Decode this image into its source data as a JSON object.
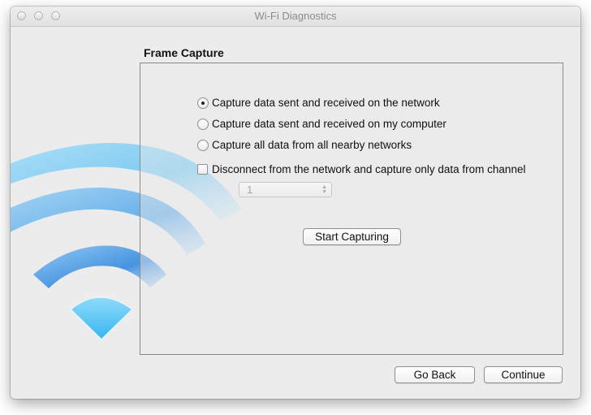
{
  "window": {
    "title": "Wi-Fi Diagnostics"
  },
  "section": {
    "title": "Frame Capture"
  },
  "capture_options": [
    {
      "label": "Capture data sent and received on the network",
      "selected": true
    },
    {
      "label": "Capture data sent and received on my computer",
      "selected": false
    },
    {
      "label": "Capture all data from all nearby networks",
      "selected": false
    }
  ],
  "disconnect": {
    "label": "Disconnect from the network and capture only data from channel",
    "checked": false
  },
  "channel": {
    "value": "1",
    "enabled": false
  },
  "buttons": {
    "start_capturing": "Start Capturing",
    "go_back": "Go Back",
    "continue": "Continue"
  },
  "icons": {
    "wifi": "wifi-icon",
    "stepper": "stepper-arrows-icon"
  },
  "colors": {
    "wifi_light": "#8fd5f6",
    "wifi_mid": "#5bb4ec",
    "wifi_dark": "#3b95e2"
  }
}
